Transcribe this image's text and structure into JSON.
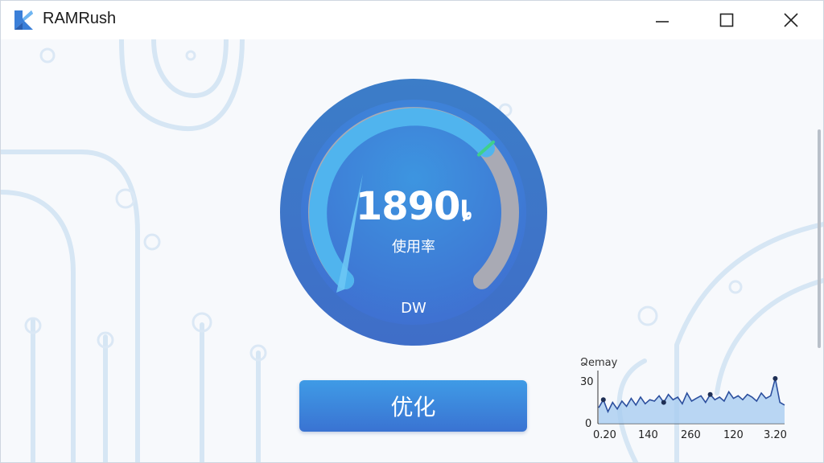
{
  "app": {
    "title": "RAMRush",
    "icon": "ramrush-logo-icon",
    "accent": "#3a86e0"
  },
  "window_controls": {
    "minimize": "minimize-icon",
    "maximize": "maximize-icon",
    "close": "close-icon"
  },
  "gauge": {
    "value": "1890",
    "suffix": "ȴ",
    "label": "使用率",
    "unit": "DW",
    "usage_fraction": 0.68,
    "colors": {
      "fill": "#4aa8ea",
      "track": "#a9aab4",
      "marker": "#3fd08a",
      "face": "#3e88dc"
    }
  },
  "optimize_button": {
    "label": "优化"
  },
  "chart_data": {
    "type": "area",
    "title": "Ձemay",
    "x_tick_labels": [
      "0.20",
      "140",
      "260",
      "120",
      "3.20"
    ],
    "y_tick_labels": [
      "30",
      "0"
    ],
    "values": [
      12,
      18,
      9,
      16,
      11,
      17,
      13,
      19,
      14,
      20,
      15,
      18,
      17,
      21,
      16,
      22,
      18,
      20,
      15,
      23,
      17,
      19,
      21,
      16,
      22,
      18,
      20,
      17,
      24,
      19,
      21,
      18,
      22,
      20,
      17,
      23,
      19,
      21,
      34,
      16,
      14
    ],
    "highlight_indices": [
      1,
      14,
      24,
      38
    ],
    "ylim": [
      0,
      40
    ],
    "colors": {
      "line": "#2c4f9e",
      "fill": "#a9cdf0"
    }
  }
}
